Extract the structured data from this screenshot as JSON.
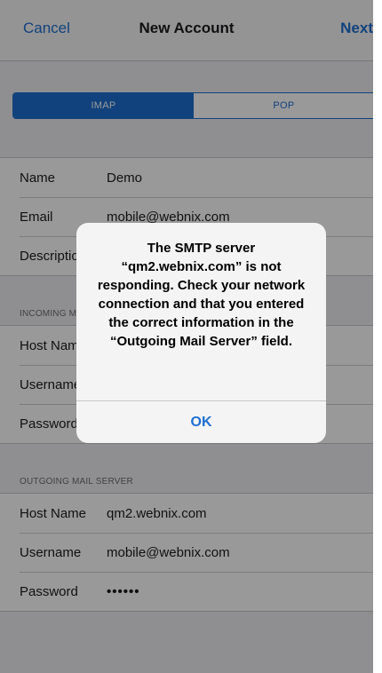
{
  "nav": {
    "cancel": "Cancel",
    "title": "New Account",
    "next": "Next"
  },
  "segmented": {
    "options": [
      "IMAP",
      "POP"
    ],
    "selected": "IMAP"
  },
  "account": {
    "name_label": "Name",
    "name_value": "Demo",
    "email_label": "Email",
    "email_value": "mobile@webnix.com",
    "description_label": "Description"
  },
  "incoming": {
    "header": "INCOMING MAIL SERVER",
    "host_label": "Host Name",
    "username_label": "Username",
    "password_label": "Password"
  },
  "outgoing": {
    "header": "OUTGOING MAIL SERVER",
    "host_label": "Host Name",
    "host_value": "qm2.webnix.com",
    "username_label": "Username",
    "username_value": "mobile@webnix.com",
    "password_label": "Password",
    "password_value": "••••••"
  },
  "alert": {
    "message": "The SMTP server “qm2.webnix.com” is not responding. Check your network connection and that you entered the correct information in the “Outgoing Mail Server” field.",
    "ok": "OK"
  },
  "colors": {
    "accent": "#1f6fd1",
    "background": "#efeff4"
  }
}
